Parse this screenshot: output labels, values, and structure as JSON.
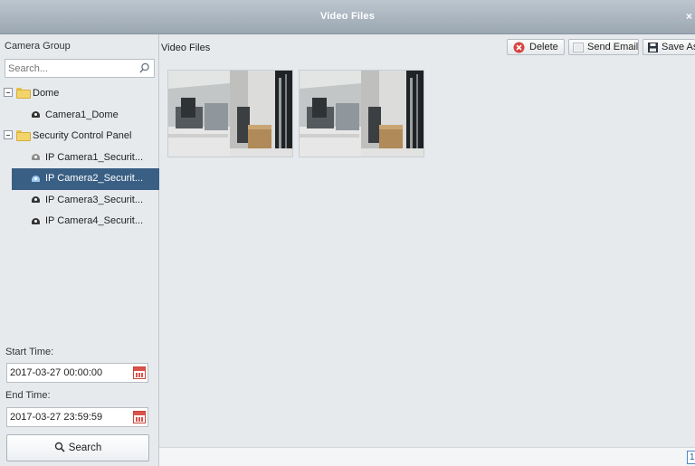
{
  "window": {
    "title": "Video Files",
    "close_glyph": "×"
  },
  "left_panel": {
    "header": "Camera Group",
    "search_placeholder": "Search...",
    "tree": [
      {
        "label": "Dome",
        "type": "group",
        "icon": "folder-icon"
      },
      {
        "label": "Camera1_Dome",
        "type": "camera",
        "icon": "camera-icon"
      },
      {
        "label": "Security Control Panel",
        "type": "group",
        "icon": "folder-icon"
      },
      {
        "label": "IP Camera1_Securit...",
        "type": "camera",
        "icon": "camera-offline-icon"
      },
      {
        "label": "IP Camera2_Securit...",
        "type": "camera",
        "icon": "camera-icon",
        "selected": true
      },
      {
        "label": "IP Camera3_Securit...",
        "type": "camera",
        "icon": "camera-icon"
      },
      {
        "label": "IP Camera4_Securit...",
        "type": "camera",
        "icon": "camera-icon"
      }
    ],
    "start_time_label": "Start Time:",
    "start_time_value": "2017-03-27 00:00:00",
    "end_time_label": "End Time:",
    "end_time_value": "2017-03-27 23:59:59",
    "search_button_label": "Search"
  },
  "main": {
    "header_label": "Video Files",
    "toolbar": {
      "delete_label": "Delete",
      "send_email_label": "Send Email",
      "save_as_label": "Save As"
    },
    "thumbnails": [
      {
        "name": "video-thumbnail-1"
      },
      {
        "name": "video-thumbnail-2"
      }
    ],
    "pagination": {
      "current_page": "1"
    }
  },
  "colors": {
    "selection": "#3a5f84",
    "title_bar": "#9aa6b1",
    "panel_bg": "#e7eaed",
    "delete_icon": "#d64541"
  }
}
